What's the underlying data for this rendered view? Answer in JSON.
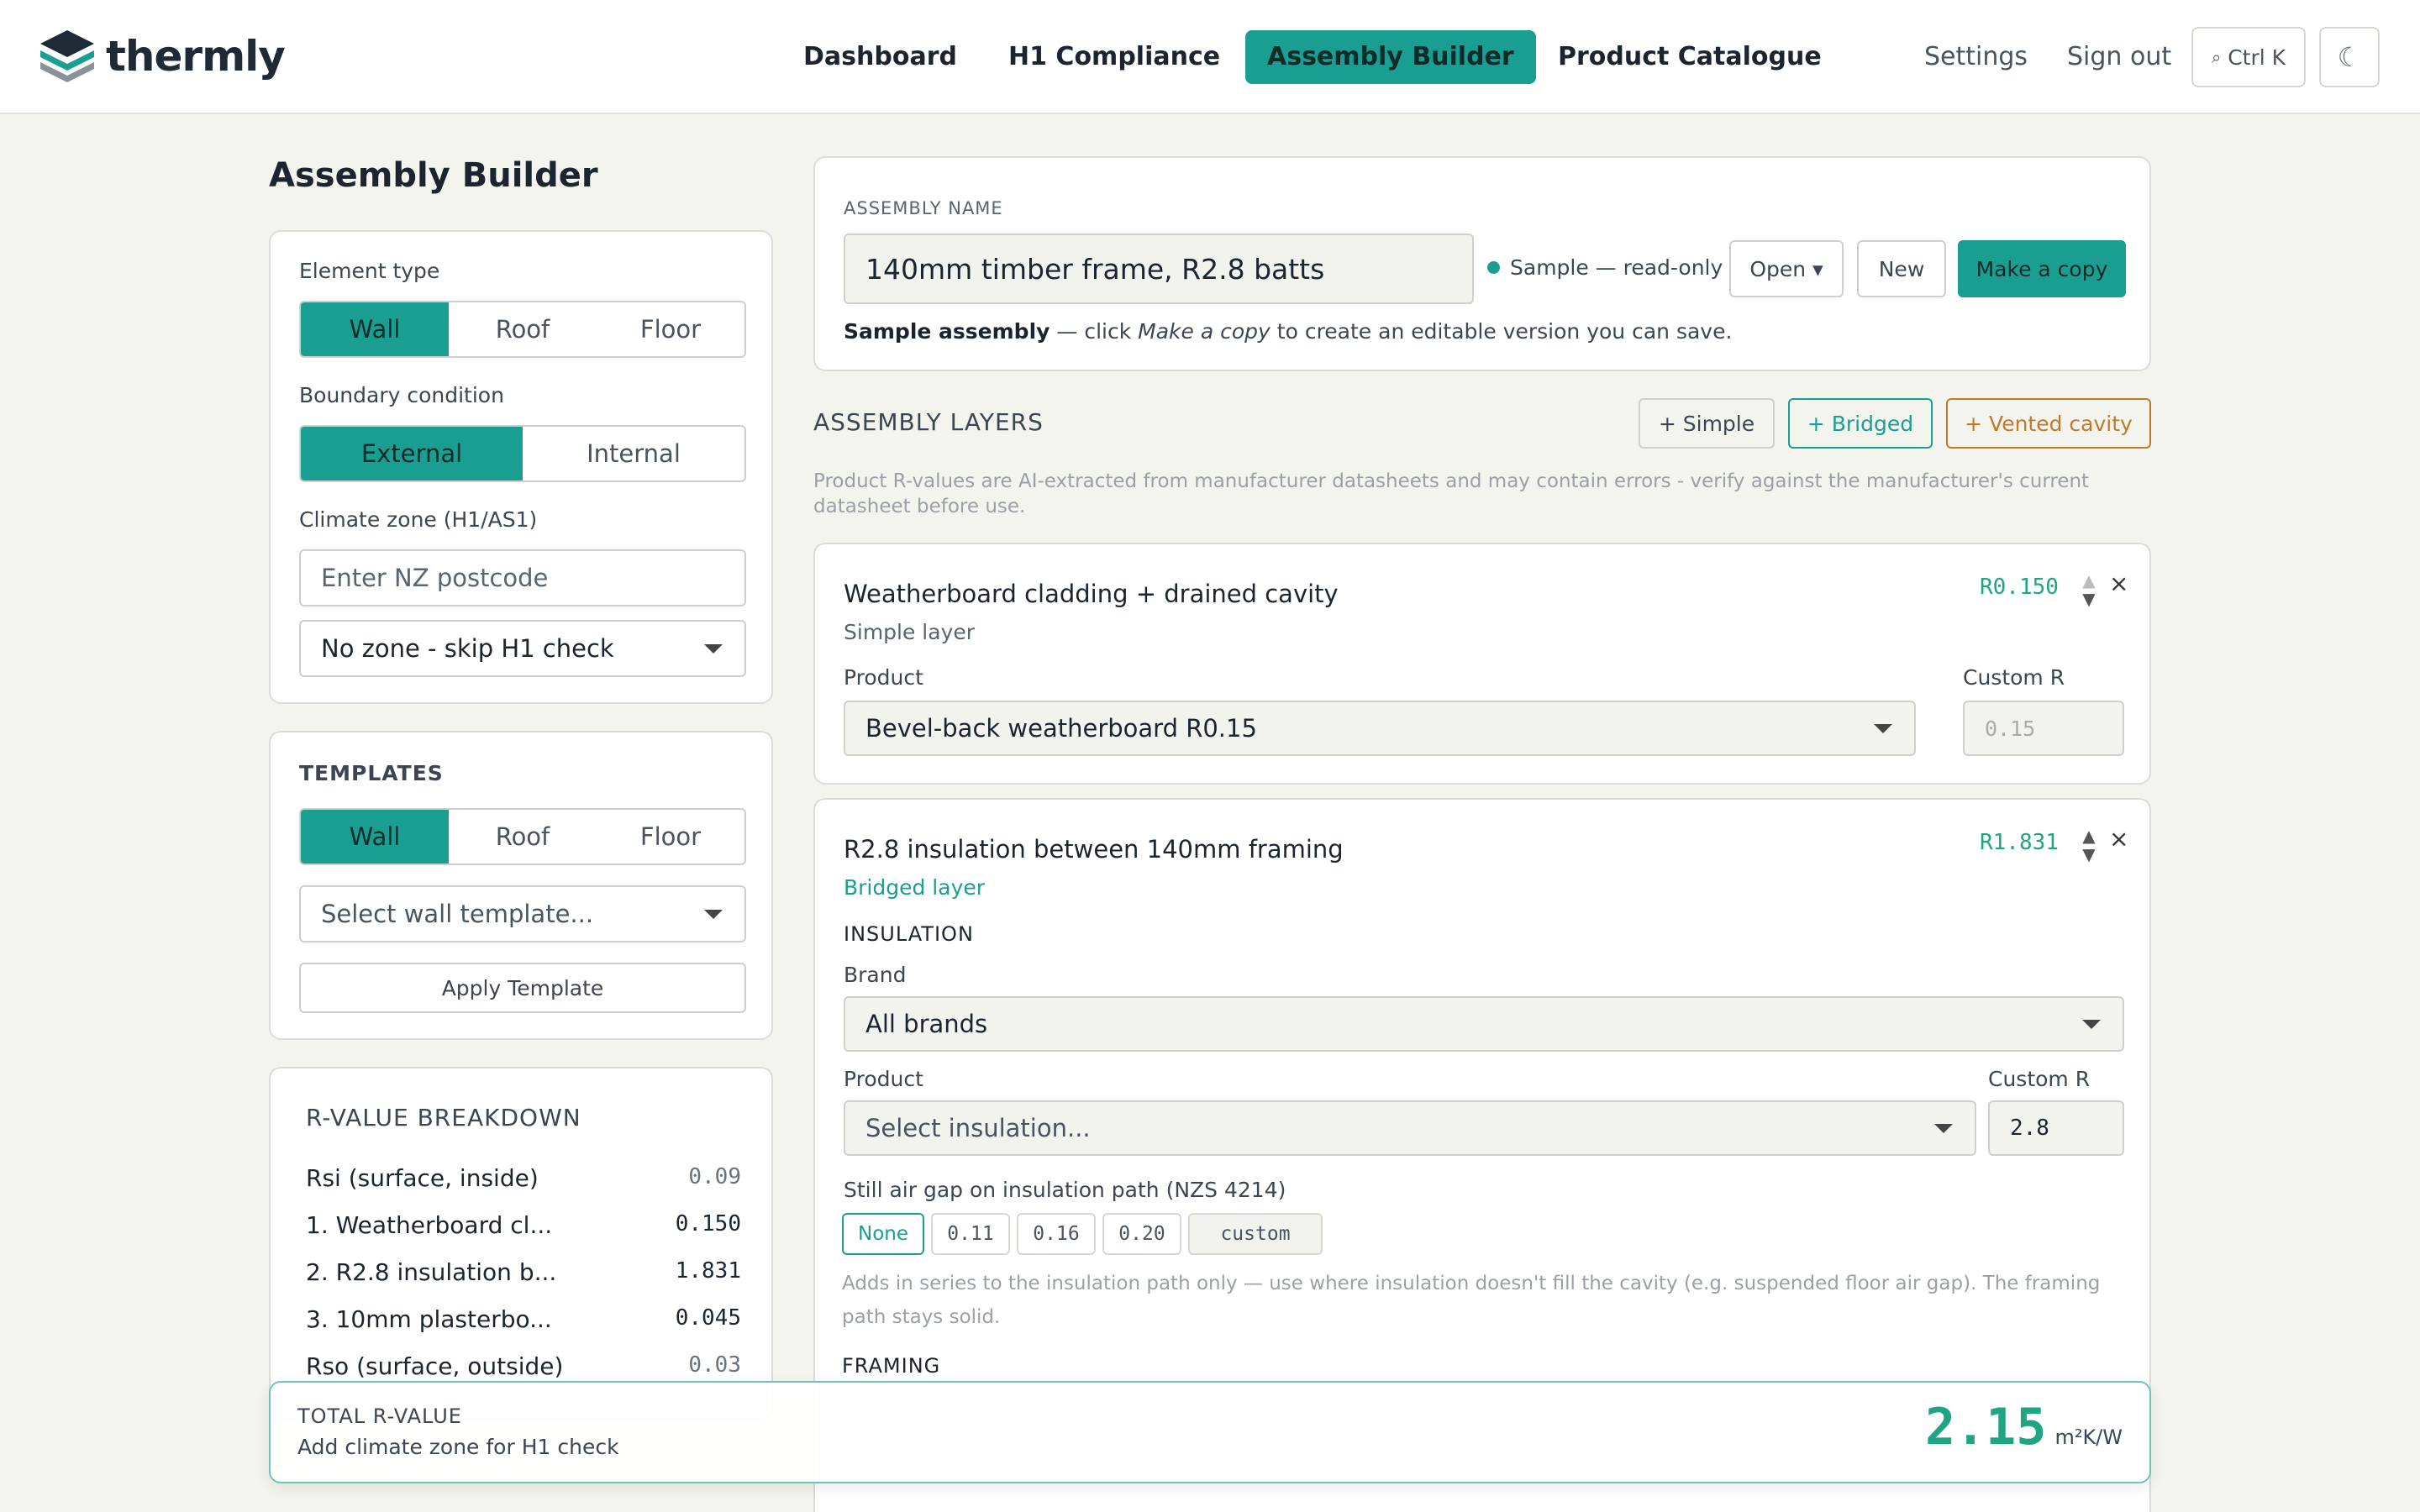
{
  "brand": {
    "name": "thermly"
  },
  "nav": {
    "tabs": [
      "Dashboard",
      "H1 Compliance",
      "Assembly Builder",
      "Product Catalogue"
    ],
    "active": "Assembly Builder",
    "settings": "Settings",
    "signout": "Sign out",
    "search_shortcut": "Ctrl K",
    "theme_icon": "moon-icon",
    "search_icon": "search-icon"
  },
  "page": {
    "title": "Assembly Builder"
  },
  "left": {
    "element_type": {
      "label": "Element type",
      "options": [
        "Wall",
        "Roof",
        "Floor"
      ],
      "selected": "Wall"
    },
    "boundary": {
      "label": "Boundary condition",
      "options": [
        "External",
        "Internal"
      ],
      "selected": "External"
    },
    "climate": {
      "label": "Climate zone (H1/AS1)",
      "postcode_placeholder": "Enter NZ postcode",
      "zone_selected": "No zone - skip H1 check"
    },
    "templates": {
      "heading": "TEMPLATES",
      "options": [
        "Wall",
        "Roof",
        "Floor"
      ],
      "selected": "Wall",
      "select_placeholder": "Select wall template...",
      "apply": "Apply Template"
    },
    "breakdown": {
      "heading": "R-VALUE BREAKDOWN",
      "rows": [
        {
          "label": "Rsi (surface, inside)",
          "value": "0.09"
        },
        {
          "label": "1. Weatherboard cl...",
          "value": "0.150"
        },
        {
          "label": "2. R2.8 insulation b...",
          "value": "1.831"
        },
        {
          "label": "3. 10mm plasterbo...",
          "value": "0.045"
        },
        {
          "label": "Rso (surface, outside)",
          "value": "0.03"
        }
      ]
    }
  },
  "assembly": {
    "name_caption": "ASSEMBLY NAME",
    "name_value": "140mm timber frame, R2.8 batts",
    "status": "Sample — read-only",
    "open": "Open ▾",
    "new": "New",
    "copy": "Make a copy",
    "note_bold": "Sample assembly",
    "note_pre": " — click ",
    "note_em": "Make a copy",
    "note_post": " to create an editable version you can save."
  },
  "layers": {
    "heading": "ASSEMBLY LAYERS",
    "add_simple": "+ Simple",
    "add_bridged": "+ Bridged",
    "add_vented": "+ Vented cavity",
    "disclaimer": "Product R-values are AI-extracted from manufacturer datasheets and may contain errors - verify against the manufacturer's current datasheet before use.",
    "items": [
      {
        "title": "Weatherboard cladding + drained cavity",
        "type": "Simple layer",
        "r": "R0.150",
        "product_label": "Product",
        "product": "Bevel-back weatherboard R0.15",
        "custom_label": "Custom R",
        "custom_value": "0.15"
      },
      {
        "title": "R2.8 insulation between 140mm framing",
        "type": "Bridged layer",
        "r": "R1.831",
        "insulation_caption": "INSULATION",
        "brand_label": "Brand",
        "brand": "All brands",
        "product_label": "Product",
        "product_placeholder": "Select insulation...",
        "custom_label": "Custom R",
        "custom_value": "2.8",
        "air_gap_label": "Still air gap on insulation path (NZS 4214)",
        "air_gap_options": [
          "None",
          "0.11",
          "0.16",
          "0.20",
          "custom"
        ],
        "air_gap_selected": "None",
        "air_gap_help": "Adds in series to the insulation path only — use where insulation doesn't fill the cavity (e.g. suspended floor air gap). The framing path stays solid.",
        "framing_caption": "FRAMING"
      }
    ]
  },
  "total": {
    "caption": "TOTAL R-VALUE",
    "note": "Add climate zone for H1 check",
    "value": "2.15",
    "unit": "m²K/W"
  },
  "colors": {
    "accent": "#1a9e92",
    "r_value": "#1fa584",
    "vented": "#c07a2a"
  }
}
